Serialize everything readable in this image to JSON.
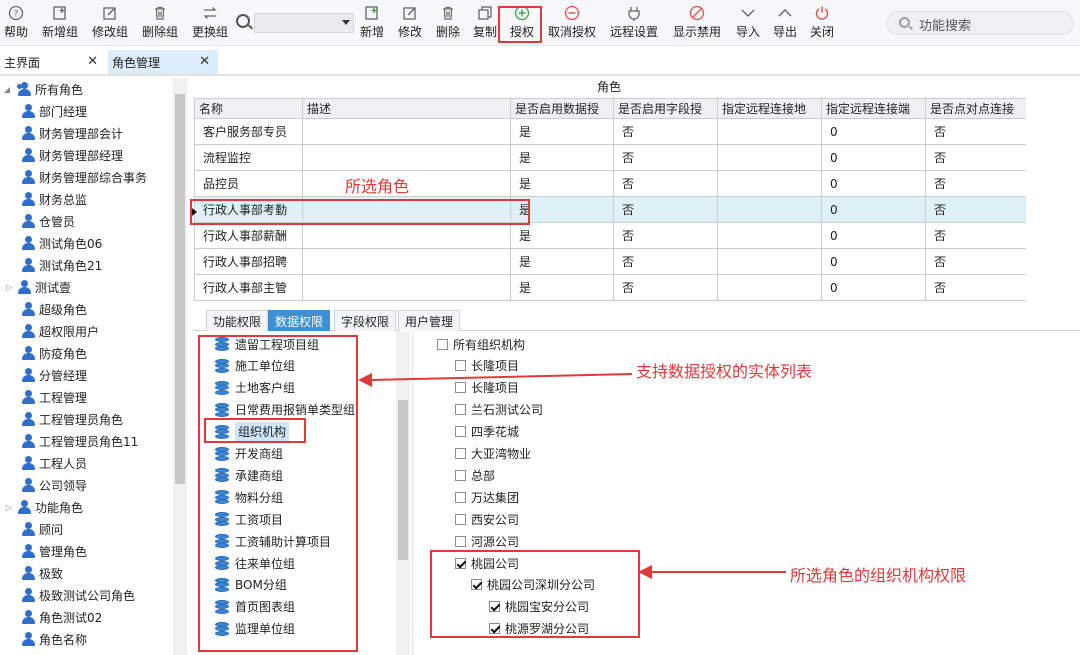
{
  "toolbar": {
    "left_buttons": [
      {
        "label": "帮助",
        "icon": "help-icon"
      },
      {
        "label": "新增组",
        "icon": "add-group-icon"
      },
      {
        "label": "修改组",
        "icon": "edit-group-icon"
      },
      {
        "label": "删除组",
        "icon": "delete-group-icon"
      },
      {
        "label": "更换组",
        "icon": "swap-group-icon"
      }
    ],
    "combo_value": "",
    "right_buttons": [
      {
        "label": "新增",
        "icon": "add-icon"
      },
      {
        "label": "修改",
        "icon": "edit-icon"
      },
      {
        "label": "删除",
        "icon": "delete-icon"
      },
      {
        "label": "复制",
        "icon": "copy-icon"
      },
      {
        "label": "授权",
        "icon": "grant-icon"
      },
      {
        "label": "取消授权",
        "icon": "revoke-icon"
      },
      {
        "label": "远程设置",
        "icon": "remote-settings-icon"
      },
      {
        "label": "显示禁用",
        "icon": "show-disabled-icon"
      },
      {
        "label": "导入",
        "icon": "import-icon"
      },
      {
        "label": "导出",
        "icon": "export-icon"
      },
      {
        "label": "关闭",
        "icon": "power-icon"
      }
    ],
    "function_search_placeholder": "功能搜索"
  },
  "tabs": [
    {
      "label": "主界面",
      "close": "✕"
    },
    {
      "label": "角色管理",
      "close": "✕"
    }
  ],
  "tree": {
    "root": "所有角色",
    "items": [
      "部门经理",
      "财务管理部会计",
      "财务管理部经理",
      "财务管理部综合事务",
      "财务总监",
      "仓管员",
      "测试角色06",
      "测试角色21",
      "测试壹",
      "超级角色",
      "超权限用户",
      "防疫角色",
      "分管经理",
      "工程管理",
      "工程管理员角色",
      "工程管理员角色11",
      "工程人员",
      "公司领导",
      "功能角色",
      "顾问",
      "管理角色",
      "极致",
      "极致测试公司角色",
      "角色测试02",
      "角色名称"
    ]
  },
  "grid": {
    "caption": "角色",
    "columns": [
      "名称",
      "描述",
      "是否启用数据授",
      "是否启用字段授",
      "指定远程连接地",
      "指定远程连接端",
      "是否点对点连接"
    ],
    "rows": [
      [
        "客户服务部专员",
        "",
        "是",
        "否",
        "",
        "0",
        "否"
      ],
      [
        "流程监控",
        "",
        "是",
        "否",
        "",
        "0",
        "否"
      ],
      [
        "品控员",
        "",
        "是",
        "否",
        "",
        "0",
        "否"
      ],
      [
        "行政人事部考勤",
        "",
        "是",
        "否",
        "",
        "0",
        "否"
      ],
      [
        "行政人事部薪酬",
        "",
        "是",
        "否",
        "",
        "0",
        "否"
      ],
      [
        "行政人事部招聘",
        "",
        "是",
        "否",
        "",
        "0",
        "否"
      ],
      [
        "行政人事部主管",
        "",
        "是",
        "否",
        "",
        "0",
        "否"
      ]
    ],
    "selected_row": 3
  },
  "subtabs": [
    "功能权限",
    "数据权限",
    "字段权限",
    "用户管理"
  ],
  "active_subtab": "数据权限",
  "entities": [
    "遗留工程项目组",
    "施工单位组",
    "土地客户组",
    "日常费用报销单类型组",
    "组织机构",
    "开发商组",
    "承建商组",
    "物料分组",
    "工资项目",
    "工资辅助计算项目",
    "往来单位组",
    "BOM分组",
    "首页图表组",
    "监理单位组"
  ],
  "selected_entity": "组织机构",
  "orgs": [
    {
      "label": "所有组织机构",
      "checked": false,
      "level": 0
    },
    {
      "label": "长隆项目",
      "checked": false,
      "level": 1
    },
    {
      "label": "长隆项目",
      "checked": false,
      "level": 1
    },
    {
      "label": "兰石测试公司",
      "checked": false,
      "level": 1
    },
    {
      "label": "四季花城",
      "checked": false,
      "level": 1
    },
    {
      "label": "大亚湾物业",
      "checked": false,
      "level": 1
    },
    {
      "label": "总部",
      "checked": false,
      "level": 1
    },
    {
      "label": "万达集团",
      "checked": false,
      "level": 1
    },
    {
      "label": "西安公司",
      "checked": false,
      "level": 1
    },
    {
      "label": "河源公司",
      "checked": false,
      "level": 1
    },
    {
      "label": "桃园公司",
      "checked": true,
      "level": 1
    },
    {
      "label": "桃园公司深圳分公司",
      "checked": true,
      "level": 2
    },
    {
      "label": "桃园宝安分公司",
      "checked": true,
      "level": 3
    },
    {
      "label": "桃源罗湖分公司",
      "checked": true,
      "level": 3
    }
  ],
  "annotations": {
    "selected_role": "所选角色",
    "entity_list": "支持数据授权的实体列表",
    "org_permission": "所选角色的组织机构权限"
  },
  "colors": {
    "accent": "#3d8fd6",
    "annotation_red": "#e23a3a",
    "selected_row": "#dff1f7",
    "user_icon": "#2f6fc9"
  }
}
